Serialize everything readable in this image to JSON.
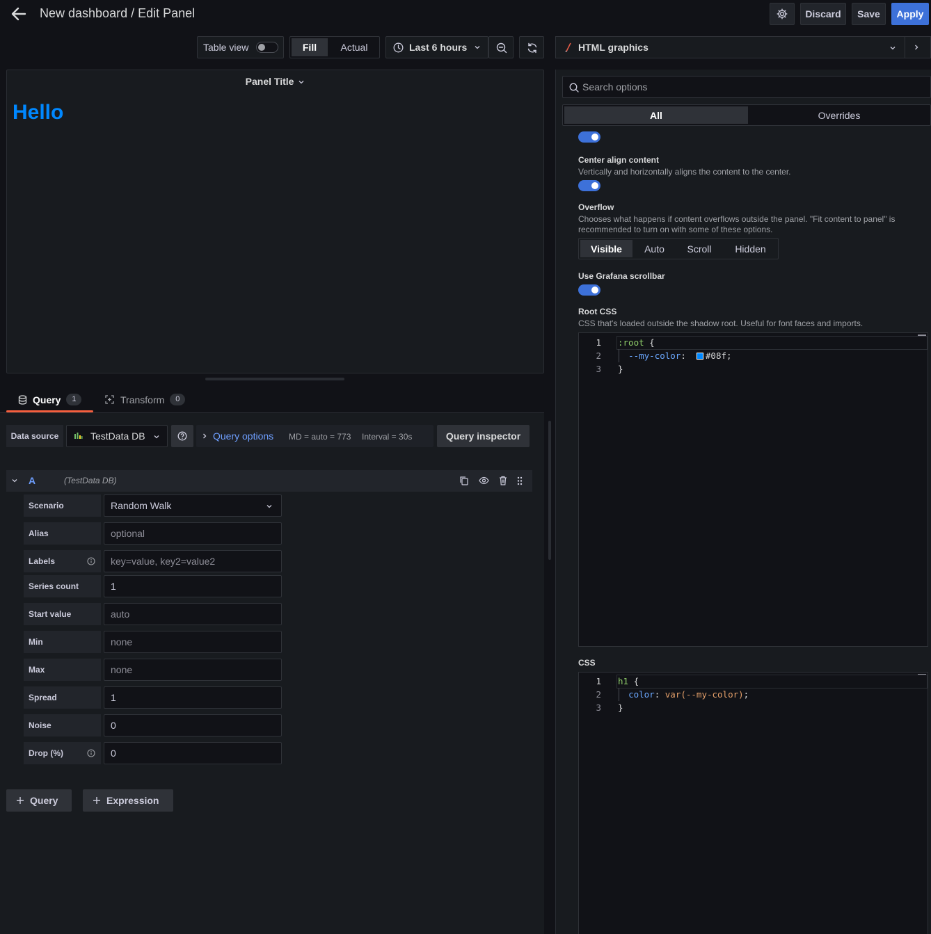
{
  "header": {
    "title": "New dashboard / Edit Panel",
    "discard_label": "Discard",
    "save_label": "Save",
    "apply_label": "Apply"
  },
  "toolbar": {
    "table_view_label": "Table view",
    "table_view_on": false,
    "fill_label": "Fill",
    "actual_label": "Actual",
    "time_range_label": "Last 6 hours"
  },
  "panel": {
    "title": "Panel Title",
    "content_text": "Hello",
    "content_color": "#0088ff"
  },
  "query_tabs": {
    "query_label": "Query",
    "query_count": "1",
    "transform_label": "Transform",
    "transform_count": "0"
  },
  "datasource": {
    "label": "Data source",
    "selected": "TestData DB",
    "query_options_label": "Query options",
    "md_text": "MD = auto = 773",
    "interval_text": "Interval = 30s",
    "inspector_label": "Query inspector"
  },
  "query_row": {
    "ref_id": "A",
    "datasource_name": "(TestData DB)"
  },
  "fields": [
    {
      "label": "Scenario",
      "value": "Random Walk",
      "placeholder": false,
      "dropdown": true,
      "info": false
    },
    {
      "label": "Alias",
      "value": "optional",
      "placeholder": true,
      "dropdown": false,
      "info": false
    },
    {
      "label": "Labels",
      "value": "key=value, key2=value2",
      "placeholder": true,
      "dropdown": false,
      "info": true
    },
    {
      "label": "Series count",
      "value": "1",
      "placeholder": false,
      "dropdown": false,
      "info": false
    },
    {
      "label": "Start value",
      "value": "auto",
      "placeholder": true,
      "dropdown": false,
      "info": false
    },
    {
      "label": "Min",
      "value": "none",
      "placeholder": true,
      "dropdown": false,
      "info": false
    },
    {
      "label": "Max",
      "value": "none",
      "placeholder": true,
      "dropdown": false,
      "info": false
    },
    {
      "label": "Spread",
      "value": "1",
      "placeholder": false,
      "dropdown": false,
      "info": false
    },
    {
      "label": "Noise",
      "value": "0",
      "placeholder": false,
      "dropdown": false,
      "info": false
    },
    {
      "label": "Drop (%)",
      "value": "0",
      "placeholder": false,
      "dropdown": false,
      "info": true
    }
  ],
  "add_buttons": {
    "query_label": "Query",
    "expression_label": "Expression"
  },
  "options": {
    "visualization": "HTML graphics",
    "search_placeholder": "Search options",
    "tab_all": "All",
    "tab_overrides": "Overrides",
    "center_align": {
      "title": "Center align content",
      "description": "Vertically and horizontally aligns the content to the center.",
      "enabled": true
    },
    "overflow": {
      "title": "Overflow",
      "description": "Chooses what happens if content overflows outside the panel. \"Fit content to panel\" is recommended to turn on with some of these options.",
      "choices": [
        "Visible",
        "Auto",
        "Scroll",
        "Hidden"
      ],
      "selected": "Visible"
    },
    "scrollbar": {
      "title": "Use Grafana scrollbar",
      "enabled": true
    },
    "root_css": {
      "title": "Root CSS",
      "description": "CSS that's loaded outside the shadow root. Useful for font faces and imports.",
      "line_numbers": [
        "1",
        "2",
        "3"
      ],
      "line1_selector": ":root",
      "line1_brace": " {",
      "line2_prop": "--my-color",
      "line2_value": "#08f",
      "line2_end": ";",
      "line3": "}"
    },
    "css": {
      "title": "CSS",
      "line_numbers": [
        "1",
        "2",
        "3"
      ],
      "line1_selector": "h1",
      "line1_brace": " {",
      "line2_prop": "color",
      "line2_value": "var(--my-color)",
      "line2_end": ";",
      "line3": "}"
    }
  },
  "colors": {
    "accent_blue": "#3d71d9",
    "tab_underline": "#f55f3e",
    "link_blue": "#6e9fff"
  }
}
